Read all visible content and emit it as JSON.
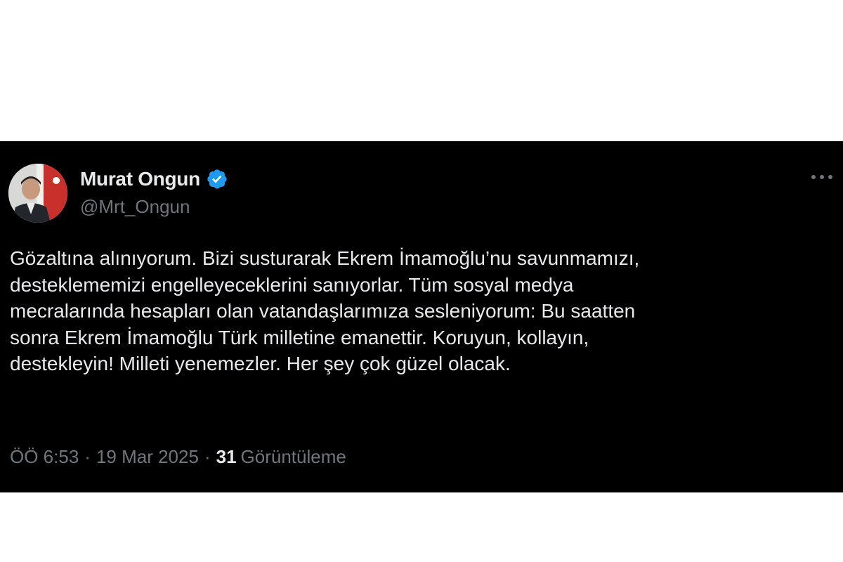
{
  "tweet": {
    "author": {
      "name": "Murat Ongun",
      "handle": "@Mrt_Ongun",
      "verified": true,
      "verified_color": "#1d9bf0"
    },
    "more_icon": "more-horizontal-icon",
    "text_lines": [
      "Gözaltına alınıyorum. Bizi susturarak Ekrem İmamoğlu’nu savunmamızı,",
      "desteklememizi engelleyeceklerini sanıyorlar. Tüm sosyal medya",
      "mecralarında hesapları olan vatandaşlarımıza sesleniyorum: Bu saatten",
      "sonra Ekrem İmamoğlu Türk milletine emanettir. Koruyun, kollayın,",
      "destekleyin! Milleti yenemezler. Her şey çok güzel olacak."
    ],
    "time": "ÖÖ 6:53",
    "separator": "·",
    "date": "19 Mar 2025",
    "views_count": "31",
    "views_label": "Görüntüleme"
  },
  "colors": {
    "card_background": "#000000",
    "primary_text": "#e7e9ea",
    "secondary_text": "#71767b"
  }
}
